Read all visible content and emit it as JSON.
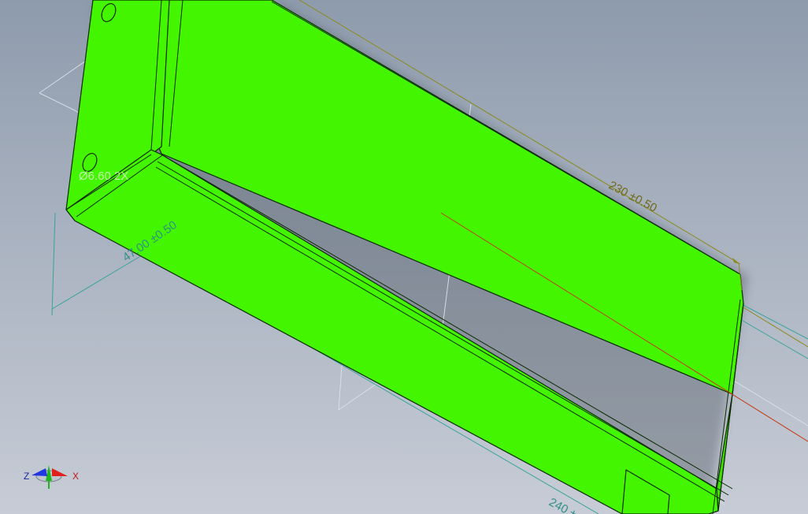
{
  "viewport": {
    "background_top": "#8e9bac",
    "background_bottom": "#c7ccd6",
    "part_color": "#44f500",
    "edge_color": "#0a2a00"
  },
  "dimensions": {
    "length_top": "230 ±0.50",
    "height_left": "47.00 ±0.50",
    "hole_note": "Ø6.60 2X",
    "length_bottom": "240 ±"
  },
  "dimension_colors": {
    "primary": "#8a8a1e",
    "reference": "#3aa39a",
    "hidden": "#dde3ea"
  },
  "triad": {
    "label_x": "X",
    "label_z": "Z",
    "x_color": "#e0201a",
    "y_color": "#1fb51f",
    "z_color": "#2037e0"
  }
}
